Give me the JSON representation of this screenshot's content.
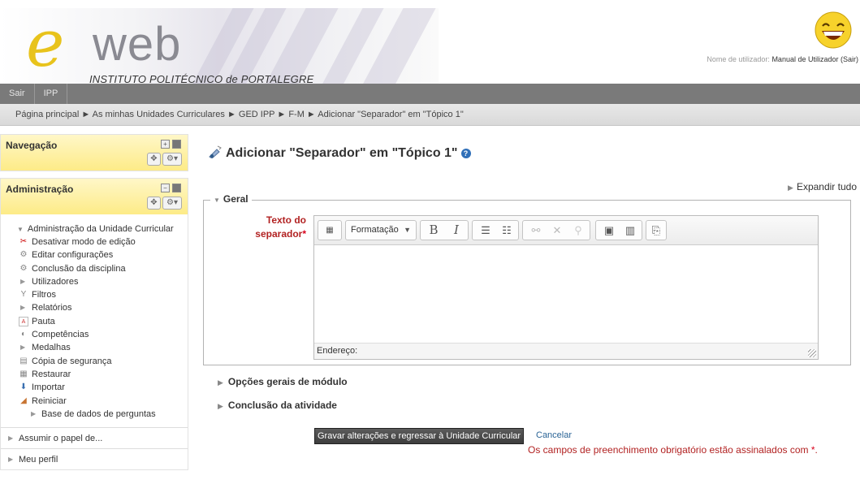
{
  "header": {
    "logo_letter": "e",
    "logo_word": "web",
    "institution": "INSTITUTO POLITÉCNICO de PORTALEGRE",
    "user_label": "Nome de utilizador:",
    "user_name": "Manual de Utilizador",
    "logout": "(Sair)"
  },
  "topbar": {
    "items": [
      "Sair",
      "IPP"
    ]
  },
  "breadcrumb": {
    "text": "Página principal ► As minhas Unidades Curriculares ► GED IPP ► F-M ► Adicionar \"Separador\" em \"Tópico 1\""
  },
  "sidebar": {
    "navigation_title": "Navegação",
    "admin_title": "Administração",
    "admin_section": "Administração da Unidade Curricular",
    "admin_items": [
      {
        "label": "Desativar modo de edição",
        "icon": "scissors-icon"
      },
      {
        "label": "Editar configurações",
        "icon": "gear-icon"
      },
      {
        "label": "Conclusão da disciplina",
        "icon": "gear-icon"
      },
      {
        "label": "Utilizadores",
        "icon": "arrow-right-icon"
      },
      {
        "label": "Filtros",
        "icon": "filter-icon"
      },
      {
        "label": "Relatórios",
        "icon": "arrow-right-icon"
      },
      {
        "label": "Pauta",
        "icon": "grades-icon"
      },
      {
        "label": "Competências",
        "icon": "competencies-icon"
      },
      {
        "label": "Medalhas",
        "icon": "arrow-right-icon"
      },
      {
        "label": "Cópia de segurança",
        "icon": "backup-icon"
      },
      {
        "label": "Restaurar",
        "icon": "restore-icon"
      },
      {
        "label": "Importar",
        "icon": "import-icon"
      },
      {
        "label": "Reiniciar",
        "icon": "reset-icon"
      },
      {
        "label": "Base de dados de perguntas",
        "icon": "arrow-right-icon"
      }
    ],
    "assume_role": "Assumir o papel de...",
    "my_profile": "Meu perfil"
  },
  "main": {
    "title": "Adicionar \"Separador\" em \"Tópico 1\"",
    "expand_all": "Expandir tudo",
    "section_general": "Geral",
    "field_label": "Texto do separador",
    "format_dropdown": "Formatação",
    "editor_status": "Endereço:",
    "section_module": "Opções gerais de módulo",
    "section_completion": "Conclusão da atividade",
    "save_button": "Gravar alterações e regressar à Unidade Curricular",
    "cancel": "Cancelar",
    "required_note": "Os campos de preenchimento obrigatório estão assinalados com",
    "required_mark": "*"
  },
  "colors": {
    "accent_red": "#b22222",
    "topbar": "#7a7a7a",
    "block_header": "#fdeb87",
    "link_blue": "#2a6496"
  }
}
